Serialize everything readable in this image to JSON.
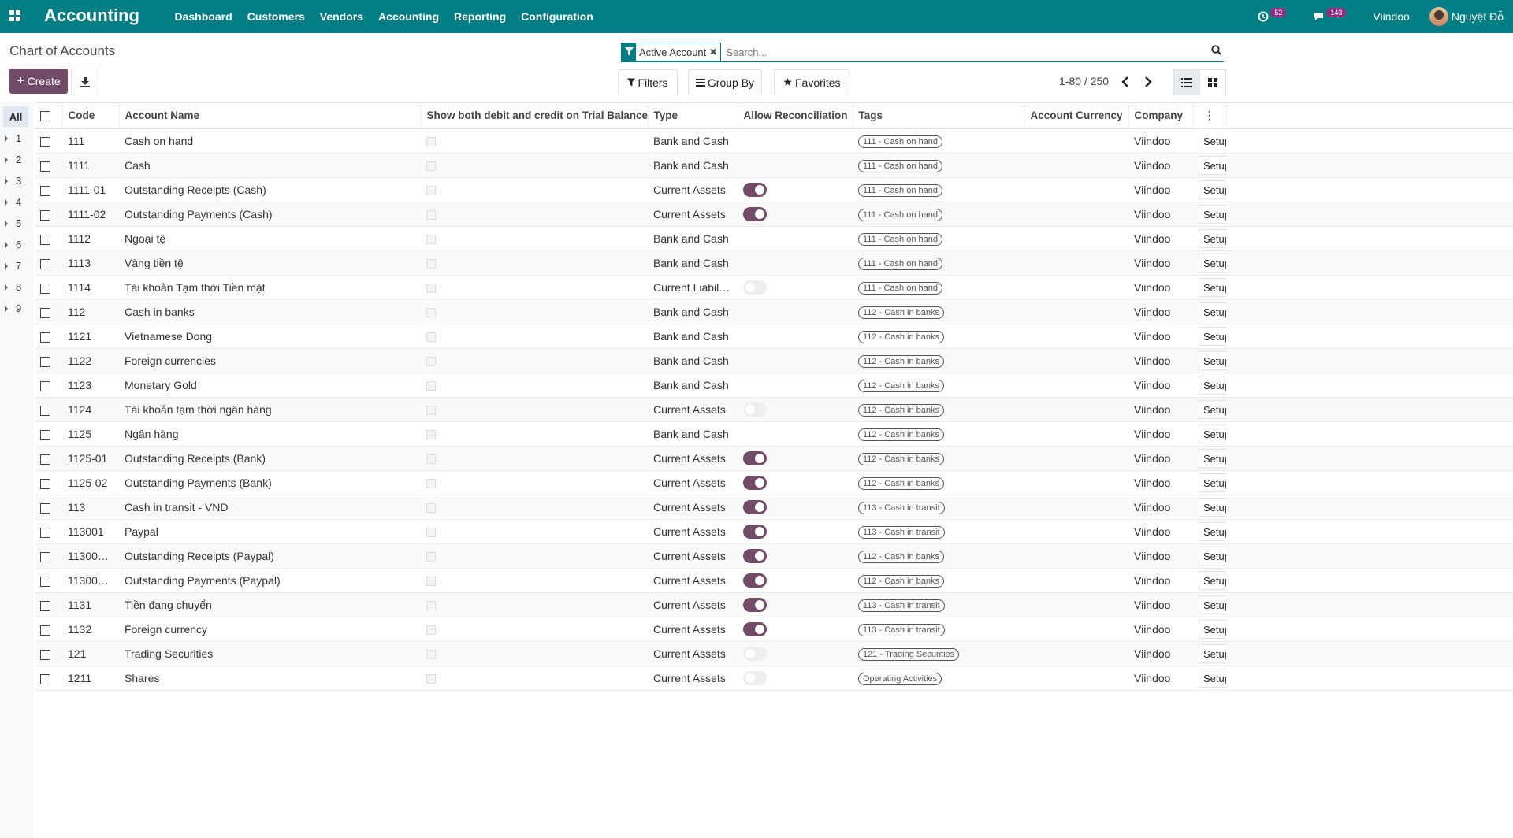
{
  "navbar": {
    "brand": "Accounting",
    "menu": [
      "Dashboard",
      "Customers",
      "Vendors",
      "Accounting",
      "Reporting",
      "Configuration"
    ],
    "activity_count": "52",
    "message_count": "143",
    "company": "Viindoo",
    "user": "Nguyệt Đỗ",
    "bg_color": "#017e84"
  },
  "page": {
    "breadcrumb": "Chart of Accounts"
  },
  "search": {
    "facet_label": "Active Account",
    "placeholder": "Search..."
  },
  "buttons": {
    "create": "Create",
    "filters": "Filters",
    "group_by": "Group By",
    "favorites": "Favorites"
  },
  "pager": {
    "value": "1-80 / 250"
  },
  "side_panel": {
    "all_label": "All",
    "items": [
      "1",
      "2",
      "3",
      "4",
      "5",
      "6",
      "7",
      "8",
      "9"
    ]
  },
  "table": {
    "headers": {
      "code": "Code",
      "name": "Account Name",
      "show_both": "Show both debit and credit on Trial Balance",
      "type": "Type",
      "reconcile": "Allow Reconciliation",
      "tags": "Tags",
      "currency": "Account Currency",
      "company": "Company"
    },
    "setup_label": "Setup",
    "rows": [
      {
        "code": "111",
        "name": "Cash on hand",
        "type": "Bank and Cash",
        "reconcile": null,
        "tag": "111 - Cash on hand",
        "company": "Viindoo"
      },
      {
        "code": "1111",
        "name": "Cash",
        "type": "Bank and Cash",
        "reconcile": null,
        "tag": "111 - Cash on hand",
        "company": "Viindoo"
      },
      {
        "code": "1111-01",
        "name": "Outstanding Receipts (Cash)",
        "type": "Current Assets",
        "reconcile": true,
        "tag": "111 - Cash on hand",
        "company": "Viindoo"
      },
      {
        "code": "1111-02",
        "name": "Outstanding Payments (Cash)",
        "type": "Current Assets",
        "reconcile": true,
        "tag": "111 - Cash on hand",
        "company": "Viindoo"
      },
      {
        "code": "1112",
        "name": "Ngoại tệ",
        "type": "Bank and Cash",
        "reconcile": null,
        "tag": "111 - Cash on hand",
        "company": "Viindoo"
      },
      {
        "code": "1113",
        "name": "Vàng tiền tệ",
        "type": "Bank and Cash",
        "reconcile": null,
        "tag": "111 - Cash on hand",
        "company": "Viindoo"
      },
      {
        "code": "1114",
        "name": "Tài khoản Tạm thời Tiền mặt",
        "type": "Current Liabilities",
        "reconcile": false,
        "tag": "111 - Cash on hand",
        "company": "Viindoo"
      },
      {
        "code": "112",
        "name": "Cash in banks",
        "type": "Bank and Cash",
        "reconcile": null,
        "tag": "112 - Cash in banks",
        "company": "Viindoo"
      },
      {
        "code": "1121",
        "name": "Vietnamese Dong",
        "type": "Bank and Cash",
        "reconcile": null,
        "tag": "112 - Cash in banks",
        "company": "Viindoo"
      },
      {
        "code": "1122",
        "name": "Foreign currencies",
        "type": "Bank and Cash",
        "reconcile": null,
        "tag": "112 - Cash in banks",
        "company": "Viindoo"
      },
      {
        "code": "1123",
        "name": "Monetary Gold",
        "type": "Bank and Cash",
        "reconcile": null,
        "tag": "112 - Cash in banks",
        "company": "Viindoo"
      },
      {
        "code": "1124",
        "name": "Tài khoản tạm thời ngân hàng",
        "type": "Current Assets",
        "reconcile": false,
        "tag": "112 - Cash in banks",
        "company": "Viindoo"
      },
      {
        "code": "1125",
        "name": "Ngân hàng",
        "type": "Bank and Cash",
        "reconcile": null,
        "tag": "112 - Cash in banks",
        "company": "Viindoo"
      },
      {
        "code": "1125-01",
        "name": "Outstanding Receipts (Bank)",
        "type": "Current Assets",
        "reconcile": true,
        "tag": "112 - Cash in banks",
        "company": "Viindoo"
      },
      {
        "code": "1125-02",
        "name": "Outstanding Payments (Bank)",
        "type": "Current Assets",
        "reconcile": true,
        "tag": "112 - Cash in banks",
        "company": "Viindoo"
      },
      {
        "code": "113",
        "name": "Cash in transit - VND",
        "type": "Current Assets",
        "reconcile": true,
        "tag": "113 - Cash in transit",
        "company": "Viindoo"
      },
      {
        "code": "113001",
        "name": "Paypal",
        "type": "Current Assets",
        "reconcile": true,
        "tag": "113 - Cash in transit",
        "company": "Viindoo"
      },
      {
        "code": "113001-...",
        "name": "Outstanding Receipts (Paypal)",
        "type": "Current Assets",
        "reconcile": true,
        "tag": "112 - Cash in banks",
        "company": "Viindoo"
      },
      {
        "code": "113001-...",
        "name": "Outstanding Payments (Paypal)",
        "type": "Current Assets",
        "reconcile": true,
        "tag": "112 - Cash in banks",
        "company": "Viindoo"
      },
      {
        "code": "1131",
        "name": "Tiền đang chuyển",
        "type": "Current Assets",
        "reconcile": true,
        "tag": "113 - Cash in transit",
        "company": "Viindoo"
      },
      {
        "code": "1132",
        "name": "Foreign currency",
        "type": "Current Assets",
        "reconcile": true,
        "tag": "113 - Cash in transit",
        "company": "Viindoo"
      },
      {
        "code": "121",
        "name": "Trading Securities",
        "type": "Current Assets",
        "reconcile": false,
        "tag": "121 - Trading Securities",
        "company": "Viindoo"
      },
      {
        "code": "1211",
        "name": "Shares",
        "type": "Current Assets",
        "reconcile": false,
        "tag": "Operating Activities",
        "company": "Viindoo"
      }
    ]
  },
  "colors": {
    "primary": "#714b67",
    "navbar": "#017e84"
  }
}
